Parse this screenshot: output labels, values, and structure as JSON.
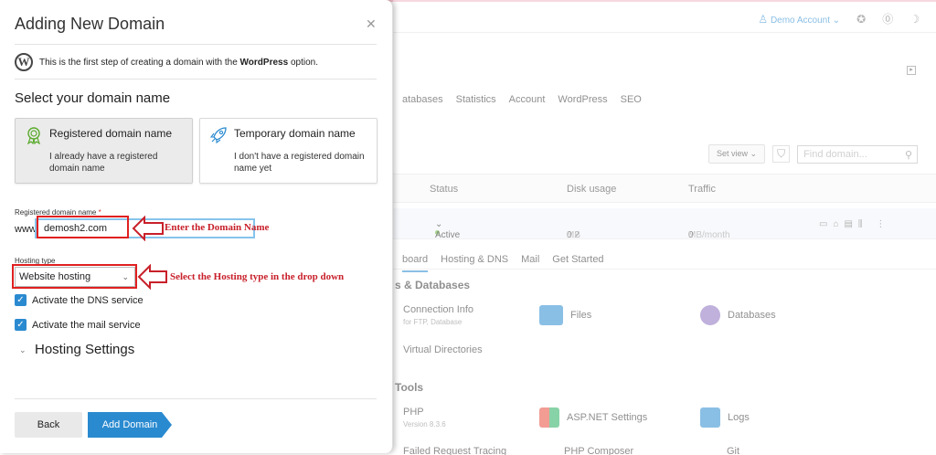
{
  "background": {
    "account_label": "Demo Account",
    "tabs": [
      "atabases",
      "Statistics",
      "Account",
      "WordPress",
      "SEO"
    ],
    "set_view": "Set view",
    "find_placeholder": "Find domain...",
    "table": {
      "headers": [
        "Status",
        "Disk usage",
        "Traffic"
      ],
      "row": {
        "status": "Active",
        "disk": "0.2",
        "disk_unit": "MB",
        "traffic": "0",
        "traffic_unit": "MB/month"
      }
    },
    "subtabs": [
      "board",
      "Hosting & DNS",
      "Mail",
      "Get Started"
    ],
    "sections": {
      "databases": "s & Databases",
      "tools": "Tools"
    },
    "tiles": {
      "connection": {
        "title": "Connection Info",
        "sub": "for FTP, Database"
      },
      "files": "Files",
      "databases": "Databases",
      "virtual": "Virtual Directories",
      "php": {
        "title": "PHP",
        "sub": "Version 8.3.6"
      },
      "aspnet": "ASP.NET Settings",
      "logs": "Logs",
      "failed": "Failed Request Tracing",
      "php_composer": "PHP Composer",
      "git": "Git"
    }
  },
  "dialog": {
    "title": "Adding New Domain",
    "info_prefix": "This is the first step of creating a domain with the ",
    "info_bold": "WordPress",
    "info_suffix": " option.",
    "section_title": "Select your domain name",
    "cards": [
      {
        "title": "Registered domain name",
        "desc": "I already have a registered domain name"
      },
      {
        "title": "Temporary domain name",
        "desc": "I don't have a registered domain name yet"
      }
    ],
    "domain_label": "Registered domain name",
    "required_mark": "*",
    "www_prefix": "www.",
    "domain_value": "demosh2.com",
    "hosting_label": "Hosting type",
    "hosting_value": "Website hosting",
    "checkbox_dns": "Activate the DNS service",
    "checkbox_mail": "Activate the mail service",
    "hosting_settings": "Hosting Settings",
    "back": "Back",
    "add": "Add Domain"
  },
  "annotations": {
    "domain": "Enter the Domain Name",
    "hosting": "Select the Hosting type in the drop down"
  },
  "colors": {
    "accent": "#2a8ad0",
    "annotation": "#c8202a"
  }
}
